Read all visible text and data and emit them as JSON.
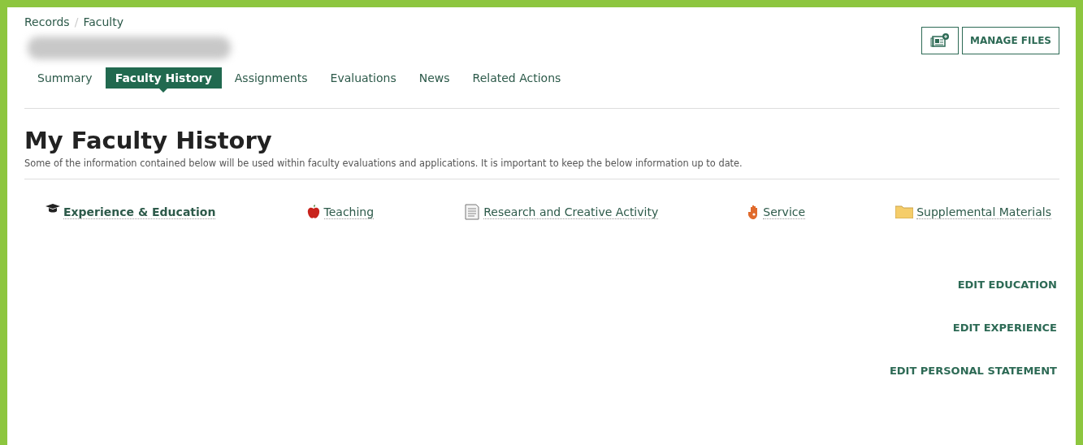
{
  "breadcrumb": [
    "Records",
    "Faculty"
  ],
  "breadcrumb_separator": "/",
  "header_actions": {
    "icon_button": {
      "kind": "add-document"
    },
    "manage_button": "MANAGE FILES"
  },
  "tabs": [
    {
      "label": "Summary",
      "selected": false
    },
    {
      "label": "Faculty History",
      "selected": true
    },
    {
      "label": "Assignments",
      "selected": false
    },
    {
      "label": "Evaluations",
      "selected": false
    },
    {
      "label": "News",
      "selected": false
    },
    {
      "label": "Related Actions",
      "selected": false
    }
  ],
  "page_title": "My Faculty History",
  "description": "Some of the information contained below will be used within faculty evaluations and applications. It is important to keep the below information up to date.",
  "sections": [
    {
      "label": "Experience & Education",
      "kind": "cap",
      "selected": true
    },
    {
      "label": "Teaching",
      "kind": "apple",
      "selected": false
    },
    {
      "label": "Research and Creative Activity",
      "kind": "document",
      "selected": false
    },
    {
      "label": "Service",
      "kind": "hand",
      "selected": false
    },
    {
      "label": "Supplemental Materials",
      "kind": "folder",
      "selected": false
    }
  ],
  "edit_links": [
    "EDIT EDUCATION",
    "EDIT EXPERIENCE",
    "EDIT PERSONAL STATEMENT"
  ]
}
